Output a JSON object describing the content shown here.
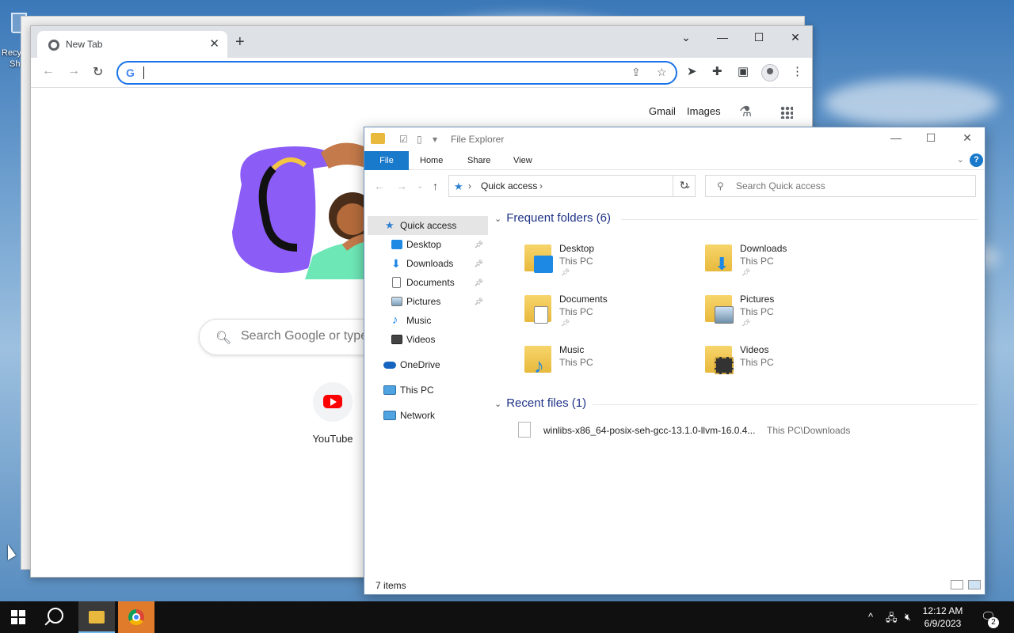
{
  "desktop": {
    "recycle_label_line1": "Recy",
    "recycle_label_line2": "Sh"
  },
  "chrome": {
    "tab_title": "New Tab",
    "tab_close": "✕",
    "new_tab": "+",
    "win_dropdown": "⌄",
    "win_minimize": "—",
    "win_maximize": "☐",
    "win_close": "✕",
    "back": "←",
    "forward": "→",
    "reload": "↻",
    "omnibox_value": "",
    "google_g": "G",
    "links": {
      "gmail": "Gmail",
      "images": "Images"
    },
    "search_placeholder": "Search Google or type",
    "shortcut_label": "YouTube"
  },
  "explorer": {
    "title": "File Explorer",
    "win_minimize": "—",
    "win_maximize": "☐",
    "win_close": "✕",
    "ribbon_tabs": {
      "file": "File",
      "home": "Home",
      "share": "Share",
      "view": "View"
    },
    "help": "?",
    "address_crumb": "Quick access",
    "search_placeholder": "Search Quick access",
    "nav": {
      "quick_access": "Quick access",
      "desktop": "Desktop",
      "downloads": "Downloads",
      "documents": "Documents",
      "pictures": "Pictures",
      "music": "Music",
      "videos": "Videos",
      "onedrive": "OneDrive",
      "this_pc": "This PC",
      "network": "Network"
    },
    "frequent_header": "Frequent folders (6)",
    "folders": [
      {
        "name": "Desktop",
        "location": "This PC"
      },
      {
        "name": "Downloads",
        "location": "This PC"
      },
      {
        "name": "Documents",
        "location": "This PC"
      },
      {
        "name": "Pictures",
        "location": "This PC"
      },
      {
        "name": "Music",
        "location": "This PC"
      },
      {
        "name": "Videos",
        "location": "This PC"
      }
    ],
    "recent_header": "Recent files (1)",
    "recent": [
      {
        "name": "winlibs-x86_64-posix-seh-gcc-13.1.0-llvm-16.0.4...",
        "location": "This PC\\Downloads"
      }
    ],
    "status_count": "7 items"
  },
  "taskbar": {
    "time": "12:12 AM",
    "date": "6/9/2023",
    "notification_count": "2",
    "tray_chevron": "^"
  },
  "colors": {
    "accent": "#1979ca",
    "group_header": "#1e3287",
    "chrome_focus": "#1a73e8"
  }
}
